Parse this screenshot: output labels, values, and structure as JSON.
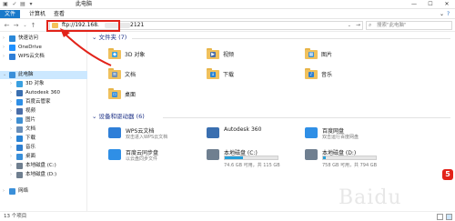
{
  "window": {
    "title": "此电脑",
    "controls": {
      "minimize": "—",
      "maximize": "☐",
      "close": "✕"
    }
  },
  "ribbon": {
    "tabs": [
      "文件",
      "计算机",
      "查看"
    ]
  },
  "address": {
    "prefix": "ftp://192.168.",
    "suffix": "2121"
  },
  "search": {
    "placeholder": "搜索\"此电脑\""
  },
  "sidebar": {
    "items": [
      {
        "label": "快速访问",
        "icon": "star-icon",
        "color": "#2b88d8"
      },
      {
        "label": "OneDrive",
        "icon": "cloud-icon",
        "color": "#1e90ff"
      },
      {
        "label": "WPS云文档",
        "icon": "wps-cloud-icon",
        "color": "#2f7fd8"
      },
      {
        "label": "此电脑",
        "icon": "computer-icon",
        "color": "#3a8fd9",
        "selected": true
      },
      {
        "label": "3D 对象",
        "icon": "cube-icon",
        "color": "#3aa0e0"
      },
      {
        "label": "Autodesk 360",
        "icon": "autodesk-icon",
        "color": "#3a6fb0"
      },
      {
        "label": "百度云管家",
        "icon": "baidu-cloud-icon",
        "color": "#2f8fe6"
      },
      {
        "label": "视频",
        "icon": "video-icon",
        "color": "#4a6ea8"
      },
      {
        "label": "图片",
        "icon": "picture-icon",
        "color": "#3f8fd2"
      },
      {
        "label": "文档",
        "icon": "document-icon",
        "color": "#6b8fb8"
      },
      {
        "label": "下载",
        "icon": "download-icon",
        "color": "#2a84d6"
      },
      {
        "label": "音乐",
        "icon": "music-icon",
        "color": "#2f7fd0"
      },
      {
        "label": "桌面",
        "icon": "desktop-icon",
        "color": "#3a8fd9"
      },
      {
        "label": "本地磁盘 (C:)",
        "icon": "drive-icon",
        "color": "#6f7f90"
      },
      {
        "label": "本地磁盘 (D:)",
        "icon": "drive-icon",
        "color": "#6f7f90"
      },
      {
        "label": "网络",
        "icon": "network-icon",
        "color": "#3a8fd9"
      }
    ]
  },
  "folders": {
    "header": "文件夹 (7)",
    "items": [
      {
        "label": "3D 对象",
        "badge": "◆",
        "badge_color": "#3aa0e0"
      },
      {
        "label": "视频",
        "badge": "▶",
        "badge_color": "#4a6ea8"
      },
      {
        "label": "图片",
        "badge": "▦",
        "badge_color": "#3f8fd2"
      },
      {
        "label": "文档",
        "badge": "≡",
        "badge_color": "#6b8fb8"
      },
      {
        "label": "下载",
        "badge": "↓",
        "badge_color": "#2a84d6"
      },
      {
        "label": "音乐",
        "badge": "♪",
        "badge_color": "#2f7fd0"
      },
      {
        "label": "桌面",
        "badge": "▭",
        "badge_color": "#3a8fd9"
      }
    ]
  },
  "devices": {
    "header": "设备和驱动器 (6)",
    "items": [
      {
        "name": "WPS云文档",
        "sub": "双击进入WPS云文档",
        "icon": "wps-cloud-icon",
        "color": "#2f7fd8"
      },
      {
        "name": "Autodesk 360",
        "sub": "",
        "icon": "autodesk-icon",
        "color": "#3a6fb0"
      },
      {
        "name": "百度网盘",
        "sub": "双击运行百度网盘",
        "icon": "baidu-netdisk-icon",
        "color": "#2f8fe6"
      },
      {
        "name": "百度云同步盘",
        "sub": "以云盘同步文件",
        "icon": "baidu-sync-icon",
        "color": "#2f8fe6"
      },
      {
        "name": "本地磁盘 (C:)",
        "free": "74.6 GB 可用，共 115 GB",
        "used_fraction": 0.35,
        "icon": "drive-c-icon",
        "color": "#6f7f90"
      },
      {
        "name": "本地磁盘 (D:)",
        "free": "758 GB 可用，共 794 GB",
        "used_fraction": 0.05,
        "icon": "drive-d-icon",
        "color": "#6f7f90"
      }
    ]
  },
  "status": {
    "count": "13 个项目"
  },
  "watermark": {
    "text": "Baidu",
    "logo": "5"
  }
}
